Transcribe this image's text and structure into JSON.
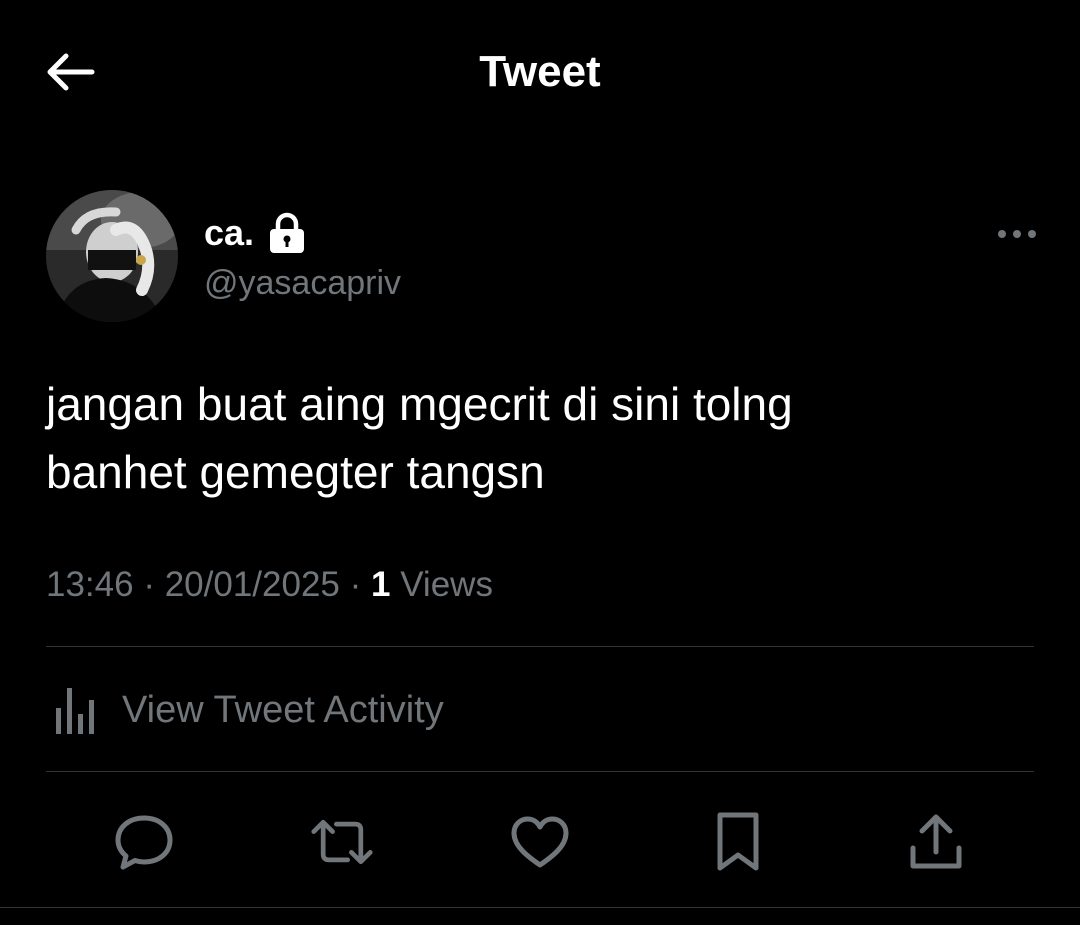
{
  "header": {
    "title": "Tweet",
    "back_icon": "arrow-left-icon"
  },
  "author": {
    "display_name": "ca.",
    "handle": "@yasacapriv",
    "protected_icon": "lock-icon",
    "avatar_icon": "avatar"
  },
  "tweet": {
    "text": "jangan buat aing mgecrit di sini tolng\nbanhet gemegter tangsn",
    "time": "13:46",
    "date": "20/01/2025",
    "separator": "·",
    "views_count": "1",
    "views_label": "Views"
  },
  "activity": {
    "label": "View Tweet Activity",
    "icon": "bar-chart-icon"
  },
  "actions": [
    {
      "icon": "reply-icon"
    },
    {
      "icon": "retweet-icon"
    },
    {
      "icon": "like-icon"
    },
    {
      "icon": "bookmark-icon"
    },
    {
      "icon": "share-icon"
    }
  ],
  "colors": {
    "background": "#000000",
    "text_primary": "#ffffff",
    "text_secondary": "#71767b",
    "divider": "#2f3336"
  }
}
